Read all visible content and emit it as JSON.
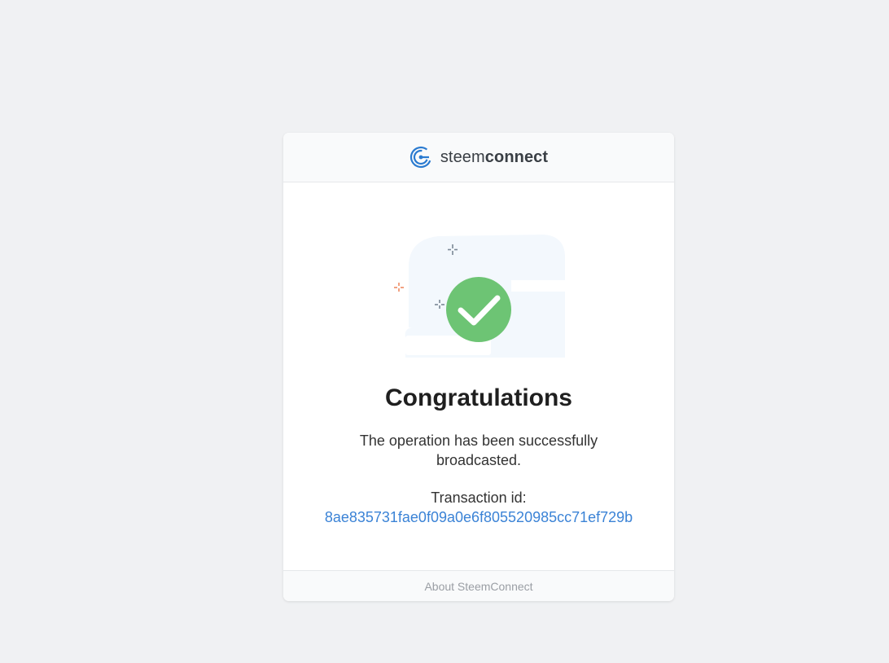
{
  "header": {
    "logo_icon": "steemconnect-logo-icon",
    "brand_light": "steem",
    "brand_bold": "connect"
  },
  "main": {
    "illustration_icon": "success-checkmark-icon",
    "title": "Congratulations",
    "message": "The operation has been successfully broadcasted.",
    "transaction_label": "Transaction id:",
    "transaction_id": "8ae835731fae0f09a0e6f805520985cc71ef729b"
  },
  "footer": {
    "link_label": "About SteemConnect"
  },
  "colors": {
    "background": "#f0f1f3",
    "accent_blue": "#3b83d6",
    "success_green": "#6dc474"
  }
}
